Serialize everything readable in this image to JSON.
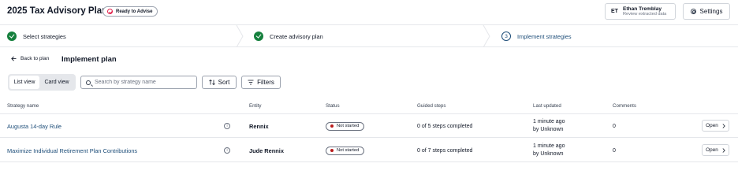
{
  "header": {
    "title": "2025 Tax Advisory Plan",
    "badge": "Ready to Advise",
    "user": {
      "initials": "ET",
      "name": "Ethan Tremblay",
      "subtitle": "Review extracted data"
    },
    "settings_label": "Settings"
  },
  "stepper": {
    "steps": [
      {
        "label": "Select strategies",
        "state": "complete"
      },
      {
        "label": "Create advisory plan",
        "state": "complete"
      },
      {
        "number": "3",
        "label": "Implement strategies",
        "state": "active"
      }
    ]
  },
  "page": {
    "back_label": "Back to plan",
    "title": "Implement plan"
  },
  "toolbar": {
    "views": [
      "List view",
      "Card view"
    ],
    "selected_view": "List view",
    "search_placeholder": "Search by strategy name",
    "search_value": "",
    "sort_label": "Sort",
    "filters_label": "Filters"
  },
  "table": {
    "columns": [
      "Strategy name",
      "Entity",
      "Status",
      "Guided steps",
      "Last updated",
      "Comments"
    ],
    "rows": [
      {
        "strategy": "Augusta 14-day Rule",
        "entity": "Rennix",
        "status": "Not started",
        "guided_steps": "0 of 5 steps completed",
        "updated_time": "1 minute ago",
        "updated_by": "by Unknown",
        "comments": "0",
        "action": "Open"
      },
      {
        "strategy": "Maximize Individual Retirement Plan Contributions",
        "entity": "Jude Rennix",
        "status": "Not started",
        "guided_steps": "0 of 7 steps completed",
        "updated_time": "1 minute ago",
        "updated_by": "by Unknown",
        "comments": "0",
        "action": "Open"
      }
    ]
  },
  "colors": {
    "accent": "#1e4e79",
    "complete": "#15803d",
    "not_started": "#b91c1c",
    "badge_icon": "#e11d48"
  },
  "icons": [
    "ready-badge-icon",
    "gear-icon",
    "check-icon",
    "back-arrow-icon",
    "search-icon",
    "sort-icon",
    "filter-icon",
    "info-icon",
    "chevron-right-icon"
  ]
}
